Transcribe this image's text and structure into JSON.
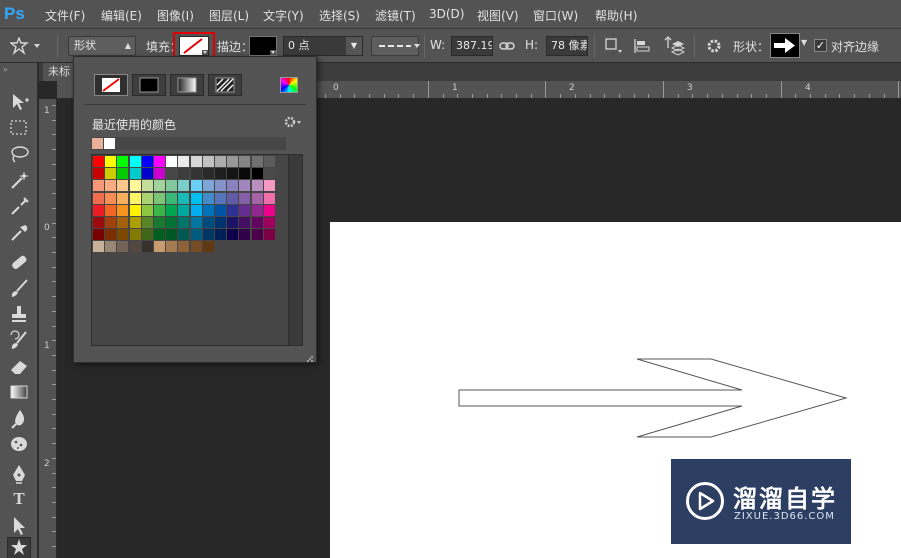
{
  "app": {
    "logo": "Ps"
  },
  "menu": [
    "文件(F)",
    "编辑(E)",
    "图像(I)",
    "图层(L)",
    "文字(Y)",
    "选择(S)",
    "滤镜(T)",
    "3D(D)",
    "视图(V)",
    "窗口(W)",
    "帮助(H)"
  ],
  "options": {
    "mode_value": "形状",
    "fill_label": "填充：",
    "stroke_label": "描边：",
    "stroke_width": "0 点",
    "w_label": "W:",
    "w_value": "387.19",
    "h_label": "H:",
    "h_value": "78 像素",
    "shape_label": "形状：",
    "align_edges_label": "对齐边缘",
    "align_edges_checked": true
  },
  "document": {
    "tab_label": "未标"
  },
  "ruler": {
    "top_numbers": [
      "0",
      "0",
      "1",
      "2",
      "3",
      "4"
    ],
    "left_numbers": [
      "1",
      "0",
      "1",
      "2"
    ]
  },
  "fill_popup": {
    "recent_label": "最近使用的颜色",
    "recent_colors": [
      "#e8b09a",
      "#ffffff"
    ],
    "swatch_rows": [
      [
        "#ff0000",
        "#ffff00",
        "#00ff00",
        "#00ffff",
        "#0000ff",
        "#ff00ff",
        "#ffffff",
        "#ebebeb",
        "#d6d6d6",
        "#c2c2c2",
        "#adadad",
        "#999999",
        "#858585",
        "#707070",
        "#5c5c5c"
      ],
      [
        "#cc0000",
        "#cccc00",
        "#00cc00",
        "#00cccc",
        "#0000cc",
        "#cc00cc",
        "#474747",
        "#3d3d3d",
        "#333333",
        "#292929",
        "#1f1f1f",
        "#141414",
        "#0a0a0a",
        "#000000",
        "#4a4a4a"
      ],
      [
        "#f7977a",
        "#f9ad81",
        "#fdc68a",
        "#fff79a",
        "#c4df9b",
        "#a3d39c",
        "#82ca9d",
        "#7bcdc8",
        "#6ecff6",
        "#7ea7d8",
        "#8493ca",
        "#8882be",
        "#a187be",
        "#bc8dbf",
        "#f49ac2"
      ],
      [
        "#f26c4f",
        "#f68e55",
        "#fbaf5c",
        "#fff467",
        "#acd372",
        "#7cc576",
        "#3bb878",
        "#1abbb4",
        "#00bff3",
        "#438cca",
        "#5574b9",
        "#605ca8",
        "#855fa8",
        "#a763a8",
        "#f06ea9"
      ],
      [
        "#ed1c24",
        "#f26522",
        "#f7941d",
        "#fff200",
        "#8dc63f",
        "#39b54a",
        "#00a651",
        "#00a99d",
        "#00aeef",
        "#0072bc",
        "#0054a6",
        "#2e3192",
        "#662d91",
        "#92278f",
        "#ec008c"
      ],
      [
        "#9e0b0f",
        "#a0410d",
        "#a36209",
        "#aba000",
        "#598527",
        "#1a7b30",
        "#007236",
        "#00746b",
        "#0076a3",
        "#004b80",
        "#003471",
        "#1b1464",
        "#440e62",
        "#630460",
        "#9e005d"
      ],
      [
        "#790000",
        "#7b2e00",
        "#7d4900",
        "#827b00",
        "#406618",
        "#005e20",
        "#005826",
        "#005952",
        "#005b7f",
        "#003663",
        "#002157",
        "#0d004c",
        "#32004b",
        "#4b0049",
        "#7b0046"
      ],
      [
        "#c7b299",
        "#998675",
        "#736357",
        "#534741",
        "#37302d",
        "#c69c6e",
        "#a67c52",
        "#8c6239",
        "#754c24",
        "#603913"
      ]
    ]
  },
  "watermark": {
    "title": "溜溜自学",
    "url": "ZIXUE.3D66.COM"
  },
  "colors": {
    "ui_panel": "#535353",
    "canvas_bg": "#282828",
    "accent_highlight": "#ff0000",
    "watermark_bg": "#2d3e63"
  },
  "icons": [
    "ps-logo-icon",
    "custom-shape-tool-icon",
    "link-icon",
    "path-operations-icon",
    "path-alignment-icon",
    "path-arrangement-icon",
    "gear-icon",
    "arrow-shape-icon",
    "checkbox-icon"
  ]
}
